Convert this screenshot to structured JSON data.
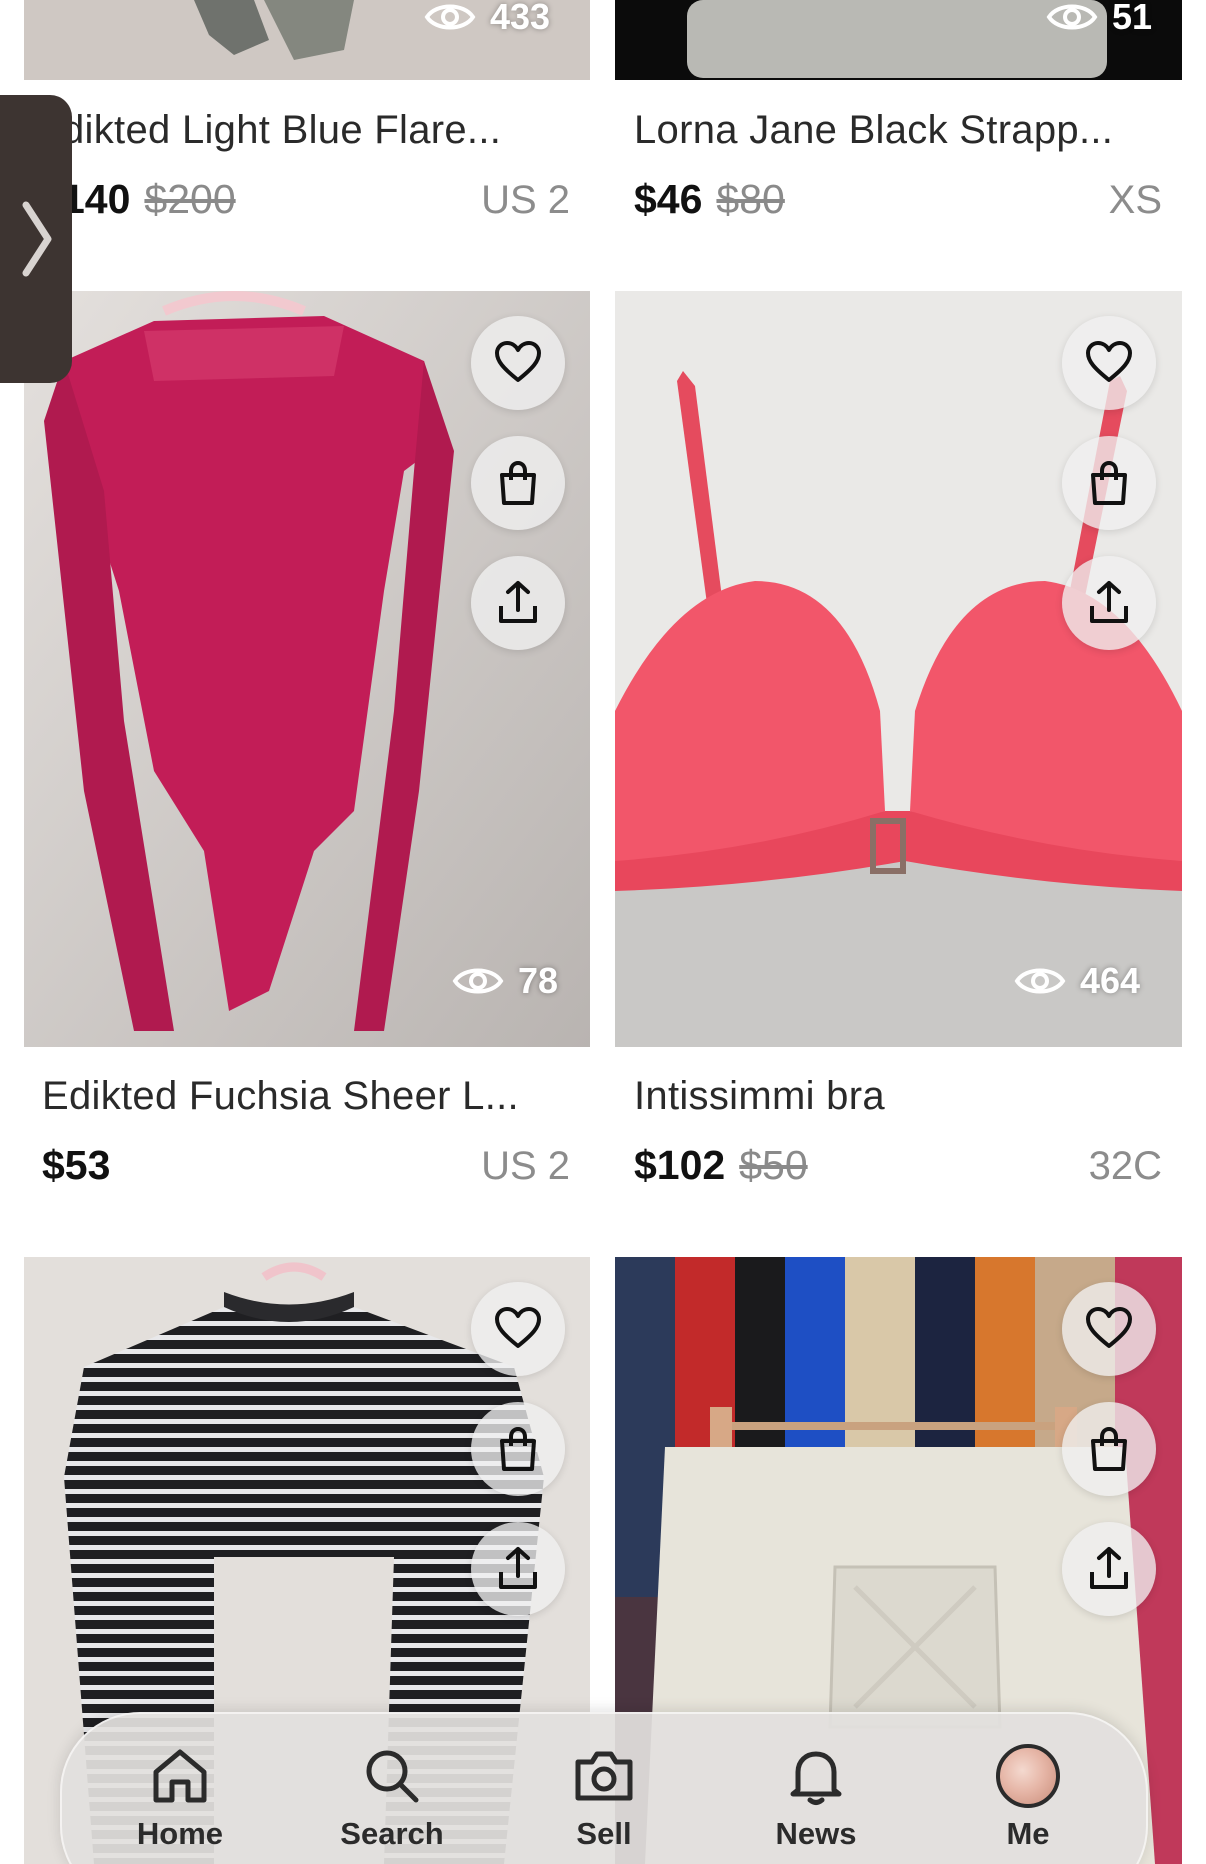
{
  "colors": {
    "background": "#ffffff",
    "price": "#111111",
    "original_price": "#8a8a8a",
    "size": "#8c8c8c",
    "nav_bar": "#e2e0de"
  },
  "listings": [
    {
      "title": "dikted Light Blue Flare...",
      "price": "140",
      "original_price": "$200",
      "size": "US 2",
      "views": "433"
    },
    {
      "title": "Lorna Jane Black Strapp...",
      "price": "$46",
      "original_price": "$80",
      "size": "XS",
      "views": "51"
    },
    {
      "title": "Edikted Fuchsia Sheer L...",
      "price": "$53",
      "original_price": "",
      "size": "US 2",
      "views": "78"
    },
    {
      "title": "Intissimmi bra",
      "price": "$102",
      "original_price": "$50",
      "size": "32C",
      "views": "464"
    },
    {
      "title": "",
      "price": "",
      "original_price": "",
      "size": "",
      "views": ""
    },
    {
      "title": "",
      "price": "",
      "original_price": "",
      "size": "",
      "views": ""
    }
  ],
  "actions": {
    "like_icon": "heart-icon",
    "bag_icon": "shopping-bag-icon",
    "share_icon": "share-icon"
  },
  "side_tab_icon": "chevron-right-icon",
  "nav": {
    "items": [
      {
        "label": "Home",
        "icon": "home-icon"
      },
      {
        "label": "Search",
        "icon": "search-icon"
      },
      {
        "label": "Sell",
        "icon": "camera-icon"
      },
      {
        "label": "News",
        "icon": "bell-icon"
      },
      {
        "label": "Me",
        "icon": "avatar"
      }
    ]
  }
}
